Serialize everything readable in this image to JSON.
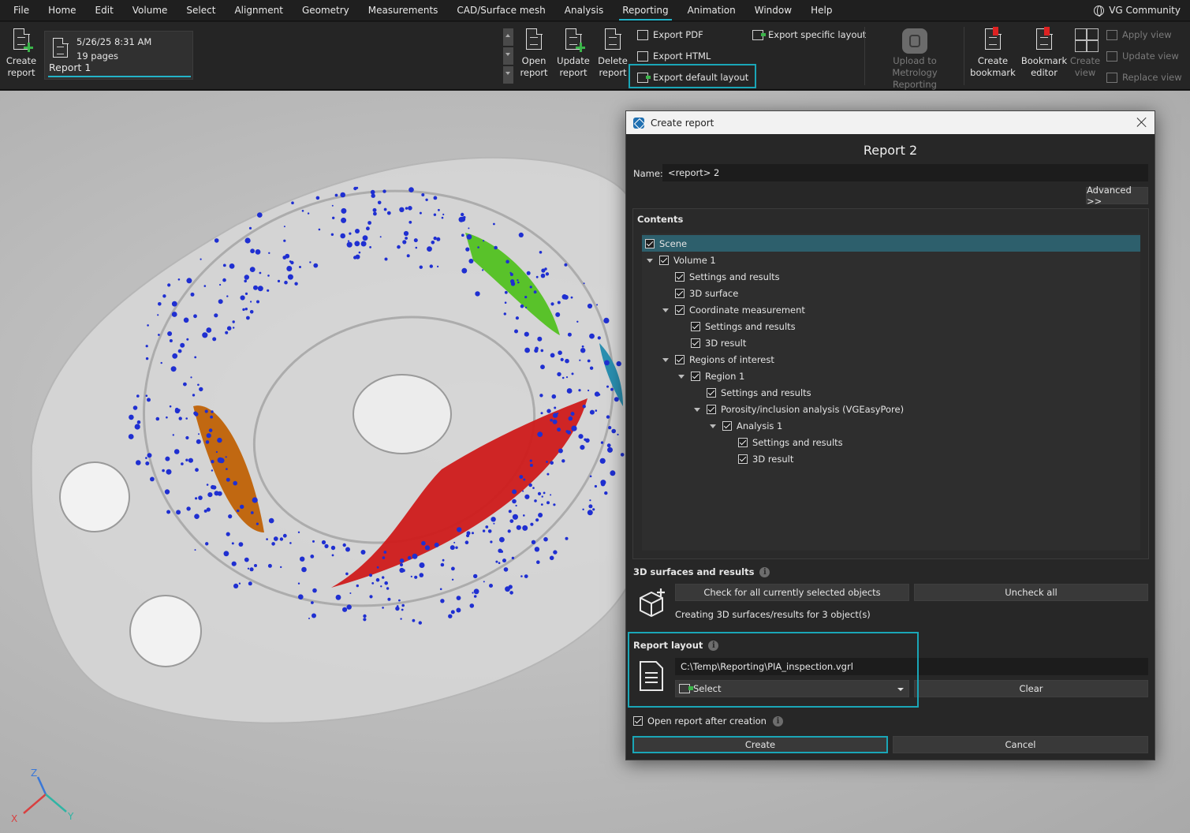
{
  "menu": {
    "items": [
      "File",
      "Home",
      "Edit",
      "Volume",
      "Select",
      "Alignment",
      "Geometry",
      "Measurements",
      "CAD/Surface mesh",
      "Analysis",
      "Reporting",
      "Animation",
      "Window",
      "Help"
    ],
    "active": "Reporting",
    "community": "VG Community"
  },
  "ribbon": {
    "create_report": {
      "line1": "Create",
      "line2": "report"
    },
    "report_card": {
      "date": "5/26/25 8:31 AM",
      "pages": "19 pages",
      "title": "Report 1"
    },
    "open_report": {
      "line1": "Open",
      "line2": "report"
    },
    "update_report": {
      "line1": "Update",
      "line2": "report"
    },
    "delete_report": {
      "line1": "Delete",
      "line2": "report"
    },
    "export_pdf": "Export PDF",
    "export_html": "Export HTML",
    "export_default_layout": "Export default layout",
    "export_specific_layout": "Export specific layout",
    "upload": {
      "line1": "Upload to Metrology",
      "line2": "Reporting"
    },
    "create_bookmark": {
      "line1": "Create",
      "line2": "bookmark"
    },
    "bookmark_editor": {
      "line1": "Bookmark",
      "line2": "editor"
    },
    "create_view": {
      "line1": "Create",
      "line2": "view"
    },
    "apply_view": "Apply view",
    "update_view": "Update view",
    "replace_view": "Replace view"
  },
  "dialog": {
    "title": "Create report",
    "heading": "Report 2",
    "name_label": "Name:",
    "name_value": "<report> 2",
    "advanced_label": "Advanced >>",
    "contents_label": "Contents",
    "tree": [
      {
        "label": "Scene",
        "level": 0,
        "expander": false,
        "checked": true,
        "selected": true
      },
      {
        "label": "Volume 1",
        "level": 0,
        "expander": true,
        "checked": true
      },
      {
        "label": "Settings and results",
        "level": 1,
        "expander": false,
        "checked": true
      },
      {
        "label": "3D surface",
        "level": 1,
        "expander": false,
        "checked": true
      },
      {
        "label": "Coordinate measurement",
        "level": 1,
        "expander": true,
        "checked": true
      },
      {
        "label": "Settings and results",
        "level": 2,
        "expander": false,
        "checked": true
      },
      {
        "label": "3D result",
        "level": 2,
        "expander": false,
        "checked": true
      },
      {
        "label": "Regions of interest",
        "level": 1,
        "expander": true,
        "checked": true
      },
      {
        "label": "Region 1",
        "level": 2,
        "expander": true,
        "checked": true
      },
      {
        "label": "Settings and results",
        "level": 3,
        "expander": false,
        "checked": true
      },
      {
        "label": "Porosity/inclusion analysis (VGEasyPore)",
        "level": 3,
        "expander": true,
        "checked": true
      },
      {
        "label": "Analysis 1",
        "level": 4,
        "expander": true,
        "checked": true
      },
      {
        "label": "Settings and results",
        "level": 5,
        "expander": false,
        "checked": true
      },
      {
        "label": "3D result",
        "level": 5,
        "expander": false,
        "checked": true
      }
    ],
    "surfaces_label": "3D surfaces and results",
    "check_all_label": "Check for all currently selected objects",
    "uncheck_all_label": "Uncheck all",
    "creating_text": "Creating 3D surfaces/results for 3 object(s)",
    "layout_label": "Report layout",
    "layout_path": "C:\\Temp\\Reporting\\PIA_inspection.vgrl",
    "select_label": "Select",
    "clear_label": "Clear",
    "open_after_label": "Open report after creation",
    "open_after_checked": true,
    "create_label": "Create",
    "cancel_label": "Cancel",
    "info_glyph": "i"
  },
  "axes": {
    "x": "X",
    "y": "Y",
    "z": "Z"
  },
  "colors": {
    "accent": "#23b3c8",
    "highlight": "#1aa6b7",
    "porosity": "#1f2fd1",
    "defect_red": "#d01818",
    "defect_green": "#5fc62b",
    "defect_orange": "#c46a12"
  }
}
